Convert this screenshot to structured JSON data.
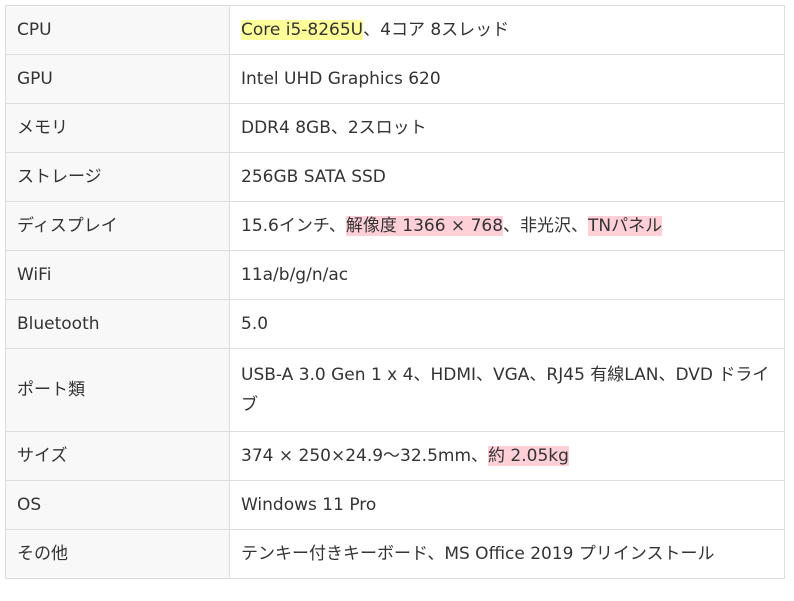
{
  "specs": [
    {
      "label": "CPU",
      "parts": [
        {
          "text": "Core i5-8265U",
          "hl": "yellow"
        },
        {
          "text": "、4コア 8スレッド",
          "hl": ""
        }
      ]
    },
    {
      "label": "GPU",
      "parts": [
        {
          "text": "Intel UHD Graphics 620",
          "hl": ""
        }
      ]
    },
    {
      "label": "メモリ",
      "parts": [
        {
          "text": "DDR4 8GB、2スロット",
          "hl": ""
        }
      ]
    },
    {
      "label": "ストレージ",
      "parts": [
        {
          "text": "256GB SATA SSD",
          "hl": ""
        }
      ]
    },
    {
      "label": "ディスプレイ",
      "parts": [
        {
          "text": "15.6インチ、",
          "hl": ""
        },
        {
          "text": "解像度 1366 × 768",
          "hl": "pink"
        },
        {
          "text": "、非光沢、",
          "hl": ""
        },
        {
          "text": "TNパネル",
          "hl": "pink"
        }
      ]
    },
    {
      "label": "WiFi",
      "parts": [
        {
          "text": "11a/b/g/n/ac",
          "hl": ""
        }
      ]
    },
    {
      "label": "Bluetooth",
      "parts": [
        {
          "text": "5.0",
          "hl": ""
        }
      ]
    },
    {
      "label": "ポート類",
      "parts": [
        {
          "text": "USB-A 3.0 Gen 1 x 4、HDMI、VGA、RJ45 有線LAN、DVD ドライブ",
          "hl": ""
        }
      ]
    },
    {
      "label": "サイズ",
      "parts": [
        {
          "text": "374 × 250×24.9～32.5mm、",
          "hl": ""
        },
        {
          "text": "約 2.05kg",
          "hl": "pink"
        }
      ]
    },
    {
      "label": "OS",
      "parts": [
        {
          "text": "Windows 11 Pro",
          "hl": ""
        }
      ]
    },
    {
      "label": "その他",
      "parts": [
        {
          "text": "テンキー付きキーボード、MS Office 2019 プリインストール",
          "hl": ""
        }
      ]
    }
  ]
}
